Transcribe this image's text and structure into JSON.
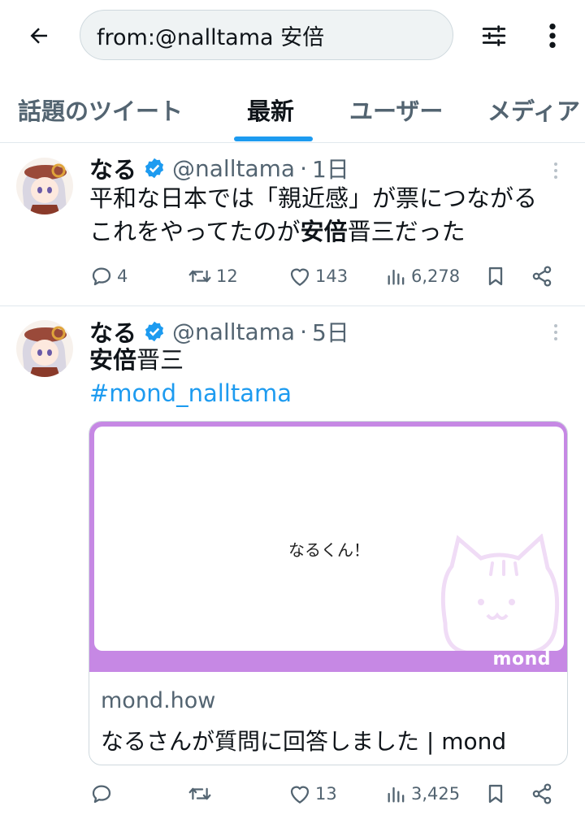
{
  "search": {
    "query": "from:@nalltama 安倍"
  },
  "tabs": [
    {
      "label": "話題のツイート"
    },
    {
      "label": "最新"
    },
    {
      "label": "ユーザー"
    },
    {
      "label": "メディア"
    }
  ],
  "active_tab": "最新",
  "colors": {
    "accent": "#1d9bf0",
    "mond_purple": "#c688e4",
    "muted": "#536471"
  },
  "tweets": [
    {
      "name": "なる",
      "handle": "@nalltama",
      "time": "1日",
      "text_line1": "平和な日本では「親近感」が票につながる",
      "text_line2_pre": "これをやってたのが",
      "text_line2_bold": "安倍",
      "text_line2_post": "晋三だった",
      "replies": "4",
      "retweets": "12",
      "likes": "143",
      "views": "6,278"
    },
    {
      "name": "なる",
      "handle": "@nalltama",
      "time": "5日",
      "text_bold": "安倍",
      "text_post": "晋三",
      "hashtag": "#mond_nalltama",
      "card": {
        "question": "なるくん！",
        "logo": "mond",
        "domain": "mond.how",
        "title": "なるさんが質問に回答しました | mond"
      },
      "replies": "",
      "retweets": "",
      "likes": "13",
      "views": "3,425"
    }
  ]
}
